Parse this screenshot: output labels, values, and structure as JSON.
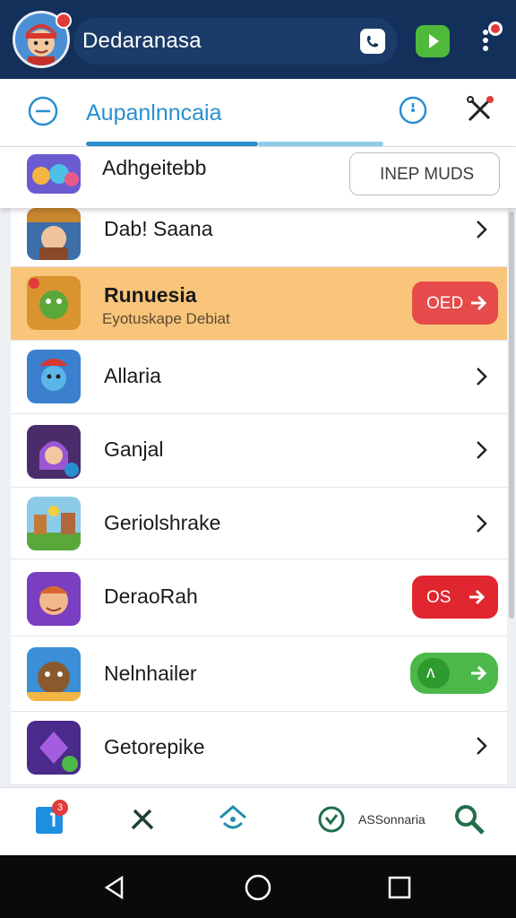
{
  "header": {
    "title": "Dedaranasa",
    "icons": [
      "avatar",
      "badge",
      "phone-icon",
      "play-icon",
      "more-vert-icon"
    ],
    "colors": {
      "bar": "#12305a",
      "play": "#4fb93a",
      "badge": "#e23b3b"
    }
  },
  "subheader": {
    "title": "Aupanlnncaia",
    "colors": {
      "accent": "#2a8fcf"
    }
  },
  "first_item": {
    "label": "Adhgeitebb",
    "button": "INEP MUDS"
  },
  "items": [
    {
      "label": "Dab! Saana",
      "sublabel": "",
      "action": "chevron"
    },
    {
      "label": "Runuesia",
      "sublabel": "Eyotuskape Debiat",
      "action": "pill",
      "pill_text": "OED",
      "highlighted": true
    },
    {
      "label": "Allaria",
      "sublabel": "",
      "action": "chevron"
    },
    {
      "label": "Ganjal",
      "sublabel": "",
      "action": "chevron"
    },
    {
      "label": "Geriolshrake",
      "sublabel": "",
      "action": "chevron"
    },
    {
      "label": "DeraoRah",
      "sublabel": "",
      "action": "pill",
      "pill_text": "OS"
    },
    {
      "label": "Nelnhailer",
      "sublabel": "",
      "action": "toggle",
      "pill_text": "ᴧ"
    },
    {
      "label": "Getorepike",
      "sublabel": "",
      "action": "chevron"
    }
  ],
  "bottom_nav": {
    "items": [
      "home-icon",
      "tools-icon",
      "house-icon",
      "check-icon",
      "search-icon"
    ],
    "label": "ASSonnaria",
    "badge": "3"
  },
  "android_nav": [
    "back-icon",
    "home-circle-icon",
    "recents-icon"
  ]
}
